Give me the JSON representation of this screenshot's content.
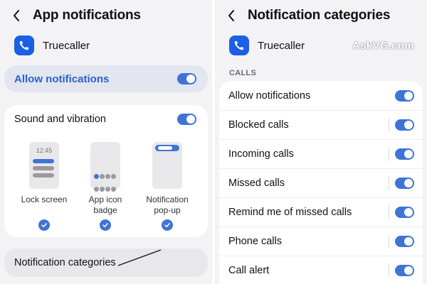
{
  "left": {
    "header": {
      "title": "App notifications"
    },
    "app": {
      "name": "Truecaller"
    },
    "allow": {
      "label": "Allow notifications",
      "enabled": true
    },
    "sound": {
      "label": "Sound and vibration",
      "enabled": true
    },
    "styles": [
      {
        "label": "Lock screen",
        "preview_time": "12:45",
        "selected": true
      },
      {
        "label": "App icon badge",
        "selected": true
      },
      {
        "label": "Notification pop-up",
        "selected": true
      }
    ],
    "categories": {
      "label": "Notification categories"
    }
  },
  "right": {
    "header": {
      "title": "Notification categories"
    },
    "app": {
      "name": "Truecaller"
    },
    "watermark": "AskVG.com",
    "section": "CALLS",
    "rows": [
      {
        "label": "Allow notifications",
        "enabled": true
      },
      {
        "label": "Blocked calls",
        "enabled": true
      },
      {
        "label": "Incoming calls",
        "enabled": true
      },
      {
        "label": "Missed calls",
        "enabled": true
      },
      {
        "label": "Remind me of missed calls",
        "enabled": true
      },
      {
        "label": "Phone calls",
        "enabled": true
      },
      {
        "label": "Call alert",
        "enabled": true
      }
    ]
  },
  "colors": {
    "accent": "#3f74d6",
    "brand": "#1a5fe6",
    "background": "#f3f3f5"
  },
  "icons": [
    "back-arrow-icon",
    "truecaller-app-icon",
    "check-icon"
  ]
}
